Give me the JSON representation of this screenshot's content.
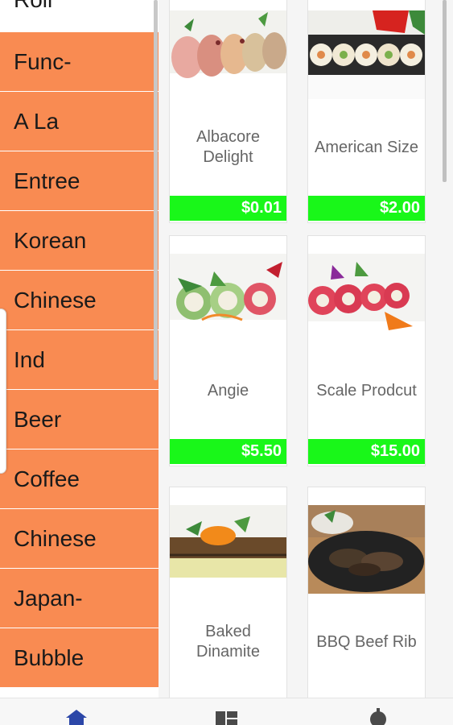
{
  "sidebar": {
    "categories": [
      "Roll",
      "Func-",
      "A La",
      "Entree",
      "Korean",
      "Chinese",
      "Ind",
      "Beer",
      "Coffee",
      "Chinese",
      "Japan-",
      "Bubble"
    ]
  },
  "products": [
    {
      "name": "Albacore Delight",
      "price": "$0.01"
    },
    {
      "name": "American Size",
      "price": "$2.00"
    },
    {
      "name": "Angie",
      "price": "$5.50"
    },
    {
      "name": "Scale Prodcut",
      "price": "$15.00"
    },
    {
      "name": "Baked Dinamite",
      "price": ""
    },
    {
      "name": "BBQ Beef Rib",
      "price": ""
    }
  ],
  "bottom_nav": {
    "items": [
      {
        "icon": "home-icon"
      },
      {
        "icon": "grid-icon"
      },
      {
        "icon": "user-icon"
      }
    ]
  },
  "colors": {
    "category_bg": "#f98b52",
    "price_bg": "#19f719",
    "nav_accent": "#2c47a8"
  }
}
